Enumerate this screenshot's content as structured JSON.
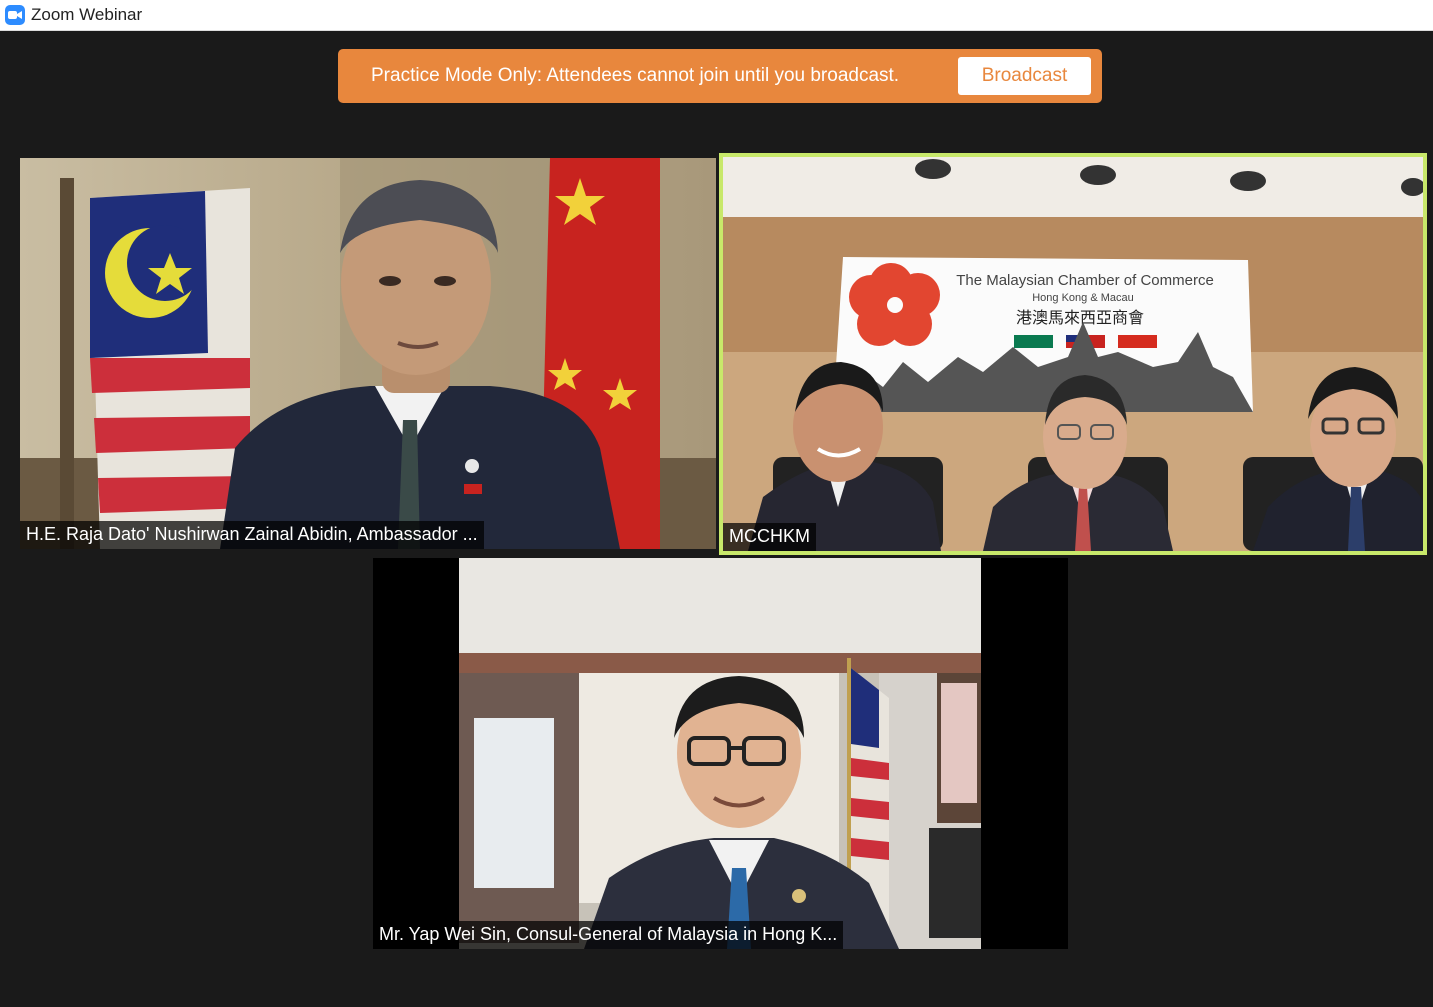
{
  "window": {
    "title": "Zoom Webinar",
    "icon": "zoom-camera-icon"
  },
  "banner": {
    "message": "Practice Mode Only: Attendees cannot join until you broadcast.",
    "button_label": "Broadcast",
    "color": "#e8873d"
  },
  "tiles": [
    {
      "name": "H.E. Raja Dato' Nushirwan Zainal Abidin, Ambassador ...",
      "active": false
    },
    {
      "name": "MCCHKM",
      "active": true
    },
    {
      "name": "Mr. Yap Wei Sin, Consul-General of Malaysia in Hong K...",
      "active": false
    }
  ],
  "banner_backdrop": {
    "org_name": "The Malaysian Chamber of Commerce",
    "region": "Hong Kong & Macau",
    "chinese_name": "港澳馬來西亞商會"
  },
  "active_speaker_color": "#c8e86a"
}
